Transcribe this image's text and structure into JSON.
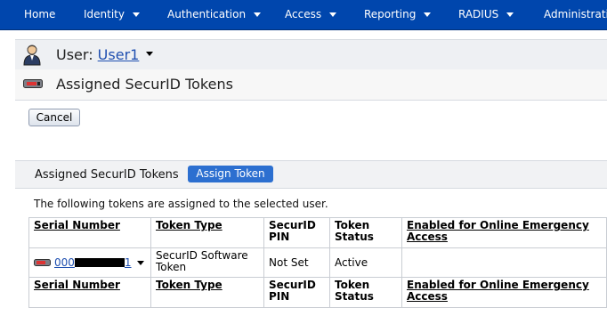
{
  "nav": {
    "items": [
      {
        "label": "Home",
        "has_menu": false
      },
      {
        "label": "Identity",
        "has_menu": true
      },
      {
        "label": "Authentication",
        "has_menu": true
      },
      {
        "label": "Access",
        "has_menu": true
      },
      {
        "label": "Reporting",
        "has_menu": true
      },
      {
        "label": "RADIUS",
        "has_menu": true
      },
      {
        "label": "Administration",
        "has_menu": false
      }
    ],
    "color": "#0046ad"
  },
  "user": {
    "prefix": "User:",
    "name": "User1"
  },
  "page": {
    "title": "Assigned SecurID Tokens"
  },
  "actions": {
    "cancel_label": "Cancel"
  },
  "section": {
    "title": "Assigned SecurID Tokens",
    "assign_label": "Assign Token",
    "info": "The following tokens are assigned to the selected user."
  },
  "table": {
    "headers": {
      "serial": "Serial Number",
      "type": "Token Type",
      "pin": "SecurID PIN",
      "status": "Token Status",
      "emergency": "Enabled for Online Emergency Access"
    },
    "rows": [
      {
        "serial_prefix": "000",
        "serial_suffix": "1",
        "type": "SecurID Software Token",
        "pin": "Not Set",
        "status": "Active",
        "emergency": ""
      }
    ]
  },
  "colors": {
    "accent": "#2c6fd0",
    "link": "#1f4fb0"
  },
  "icons": {
    "user": "user-icon",
    "token": "token-icon"
  }
}
